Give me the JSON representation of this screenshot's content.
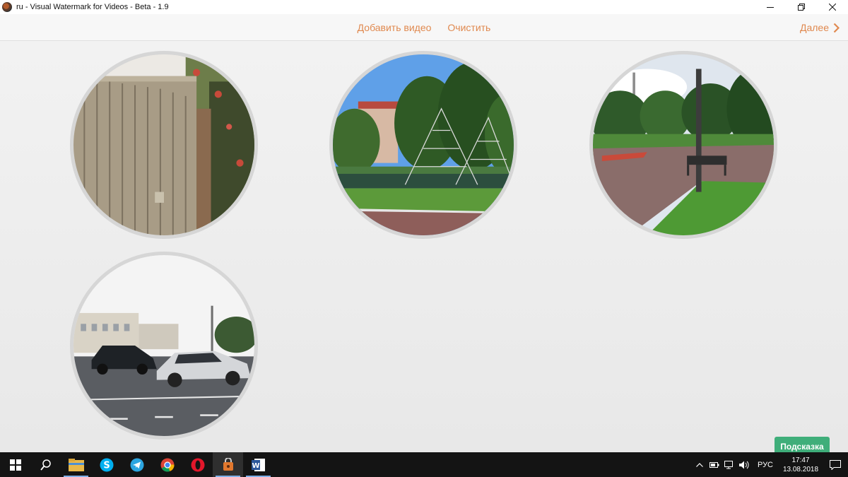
{
  "window": {
    "title": "ru - Visual Watermark for Videos - Beta - 1.9",
    "icons": {
      "minimize": "minimize-icon",
      "restore": "restore-icon",
      "close": "close-icon"
    }
  },
  "toolbar": {
    "add_video_label": "Добавить видео",
    "clear_label": "Очистить",
    "next_label": "Далее",
    "next_icon": "chevron-right-icon"
  },
  "videos": [
    {
      "scene": "fence"
    },
    {
      "scene": "playground"
    },
    {
      "scene": "park-path"
    },
    {
      "scene": "street-cars"
    }
  ],
  "hint_label": "Подсказка",
  "colors": {
    "accent": "#e0894f",
    "hint": "#3fae7a",
    "taskbar": "#141414"
  },
  "taskbar": {
    "apps": [
      "start-icon",
      "search-icon",
      "file-explorer-icon",
      "skype-icon",
      "telegram-icon",
      "chrome-icon",
      "opera-icon",
      "visual-watermark-icon",
      "word-icon"
    ],
    "language": "РУС",
    "time": "17:47",
    "date": "13.08.2018"
  }
}
